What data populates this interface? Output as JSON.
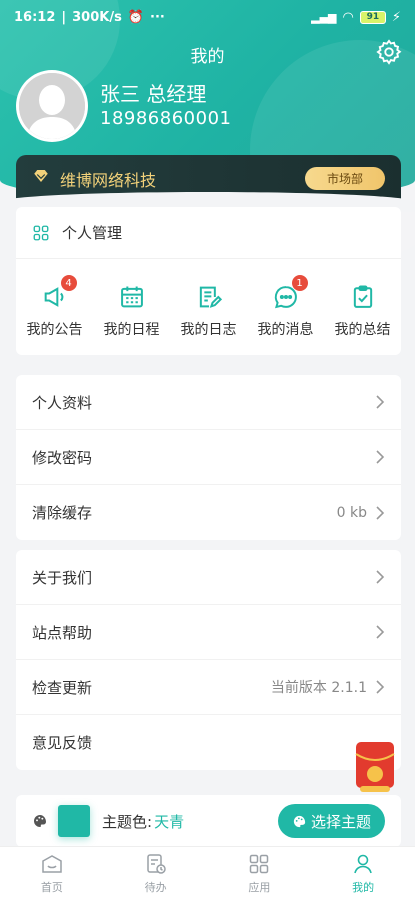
{
  "status_bar": {
    "time": "16:12",
    "speed": "300K/s",
    "dots": "···",
    "battery": "91"
  },
  "header": {
    "title": "我的",
    "user_name": "张三 总经理",
    "phone": "18986860001"
  },
  "company": {
    "name": "维博网络科技",
    "department": "市场部"
  },
  "personal_management": {
    "title": "个人管理",
    "shortcuts": [
      {
        "label": "我的公告",
        "badge": "4",
        "icon": "megaphone-icon"
      },
      {
        "label": "我的日程",
        "badge": null,
        "icon": "calendar-icon"
      },
      {
        "label": "我的日志",
        "badge": null,
        "icon": "log-icon"
      },
      {
        "label": "我的消息",
        "badge": "1",
        "icon": "message-icon"
      },
      {
        "label": "我的总结",
        "badge": null,
        "icon": "clipboard-icon"
      }
    ]
  },
  "settings_list": [
    {
      "label": "个人资料",
      "value": ""
    },
    {
      "label": "修改密码",
      "value": ""
    },
    {
      "label": "清除缓存",
      "value": "0 kb"
    }
  ],
  "about_list": [
    {
      "label": "关于我们",
      "value": ""
    },
    {
      "label": "站点帮助",
      "value": ""
    },
    {
      "label": "检查更新",
      "value": "当前版本 2.1.1"
    },
    {
      "label": "意见反馈",
      "value": ""
    }
  ],
  "theme": {
    "label": "主题色:",
    "value": "天青",
    "button": "选择主题",
    "accent": "#20b8a6"
  },
  "tabbar": [
    {
      "label": "首页",
      "icon": "home-icon",
      "active": false
    },
    {
      "label": "待办",
      "icon": "todo-icon",
      "active": false
    },
    {
      "label": "应用",
      "icon": "apps-icon",
      "active": false
    },
    {
      "label": "我的",
      "icon": "user-icon",
      "active": true
    }
  ]
}
